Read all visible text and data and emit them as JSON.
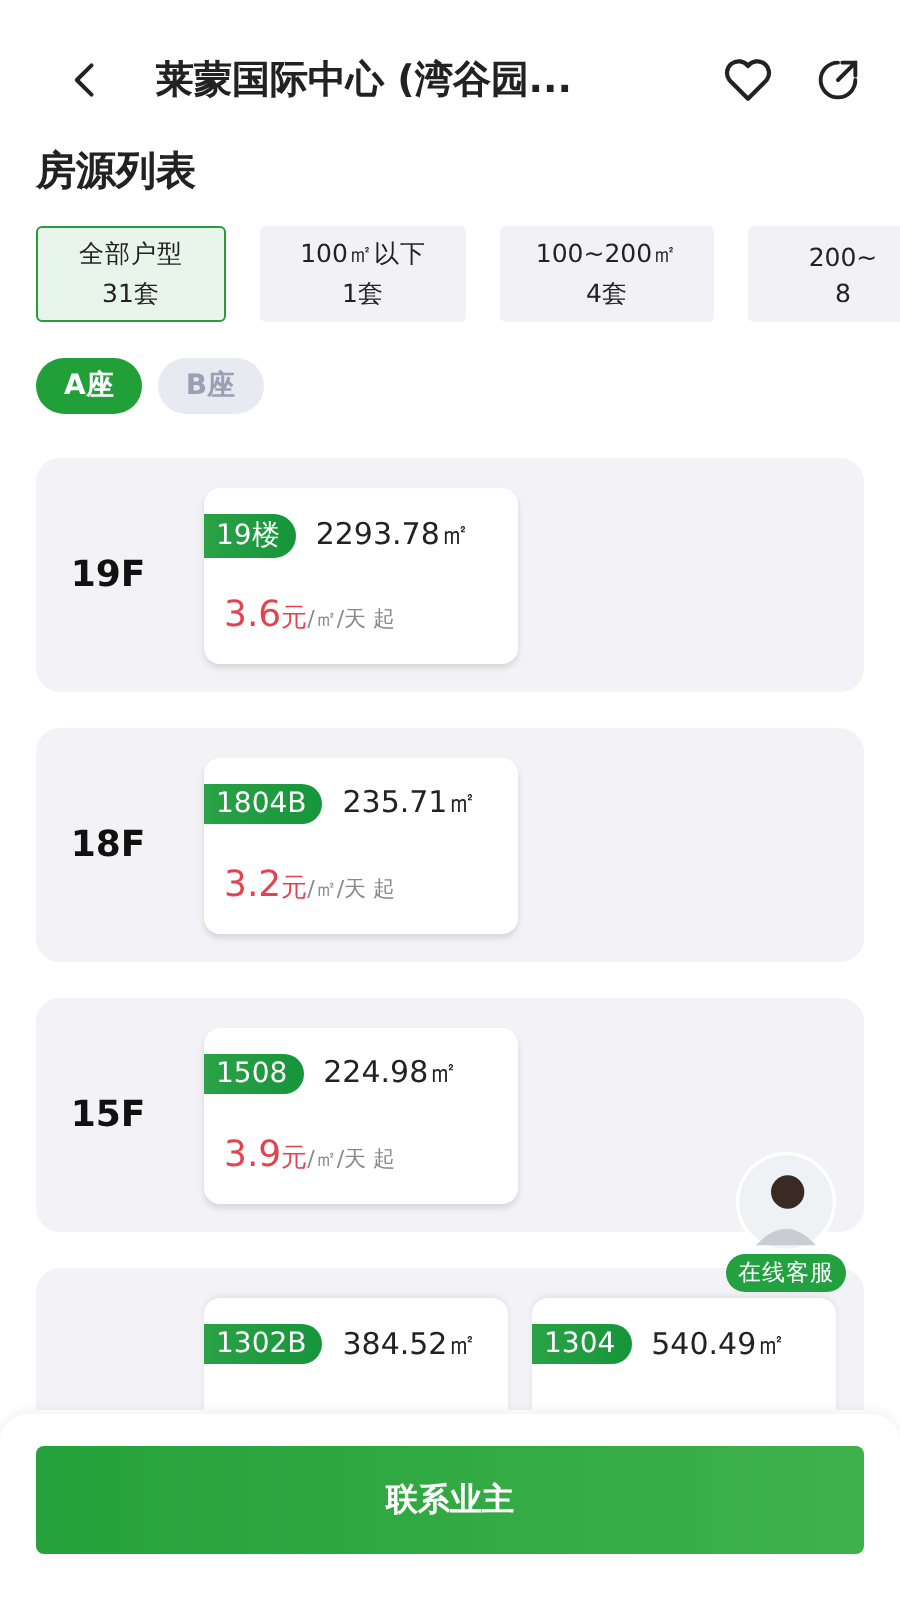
{
  "header": {
    "title": "莱蒙国际中心 (湾谷园..."
  },
  "section_title": "房源列表",
  "filters": [
    {
      "label": "全部户型",
      "count": "31套",
      "selected": true
    },
    {
      "label": "100㎡以下",
      "count": "1套",
      "selected": false
    },
    {
      "label": "100~200㎡",
      "count": "4套",
      "selected": false
    },
    {
      "label": "200~",
      "count": "8",
      "selected": false
    }
  ],
  "buildings": [
    {
      "label": "A座",
      "selected": true
    },
    {
      "label": "B座",
      "selected": false
    }
  ],
  "floors": [
    {
      "floor": "19F",
      "units": [
        {
          "unit": "19楼",
          "area": "2293.78㎡",
          "price": "3.6",
          "currency": "元",
          "suffix": "/㎡/天 起"
        }
      ]
    },
    {
      "floor": "18F",
      "units": [
        {
          "unit": "1804B",
          "area": "235.71㎡",
          "price": "3.2",
          "currency": "元",
          "suffix": "/㎡/天 起"
        }
      ]
    },
    {
      "floor": "15F",
      "units": [
        {
          "unit": "1508",
          "area": "224.98㎡",
          "price": "3.9",
          "currency": "元",
          "suffix": "/㎡/天 起"
        }
      ]
    },
    {
      "units": [
        {
          "unit": "1302B",
          "area": "384.52㎡"
        },
        {
          "unit": "1304",
          "area": "540.49㎡"
        }
      ]
    }
  ],
  "service": {
    "label": "在线客服"
  },
  "contact_button": "联系业主"
}
